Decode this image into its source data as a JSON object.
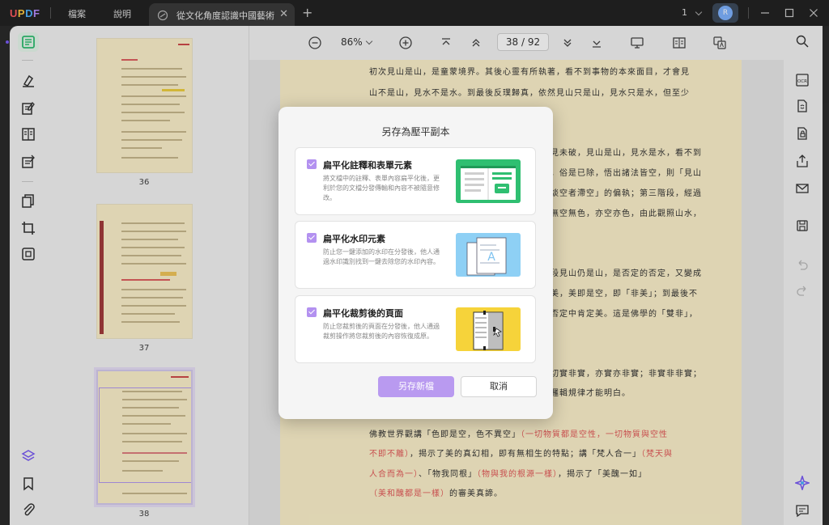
{
  "app": {
    "logo_u": "U",
    "logo_p": "P",
    "logo_d": "D",
    "logo_f": "F"
  },
  "menu": {
    "file": "檔案",
    "help": "說明"
  },
  "tab": {
    "title": "從文化角度認識中國藝術"
  },
  "titlebar": {
    "page_count": "1",
    "avatar_initial": "R"
  },
  "toolbar": {
    "zoom": "86%",
    "current_page": "38",
    "page_separator": "/",
    "total_pages": "92"
  },
  "thumbnails": [
    {
      "label": "36"
    },
    {
      "label": "37"
    },
    {
      "label": "38"
    }
  ],
  "document": {
    "lines": [
      {
        "text": "初次見山是山，是童蒙境界。其後心靈有所執著，看不到事物的本來面目，才會見"
      },
      {
        "text": "山不是山，見水不是水。到最後反璞歸真，依然見山只是山，見水只是水，但至少"
      },
      {
        "text": "見未破，見山是山，見水是水，看不到"
      },
      {
        "text": "，俗是已除，悟出諸法皆空，則「見山"
      },
      {
        "text": "談空者滯空」的偏執；第三階段，經過"
      },
      {
        "text": "無空無色，亦空亦色，由此觀照山水，"
      },
      {
        "text": "段見山仍是山，是否定的否定，又變成"
      },
      {
        "text": "美，美即是空，即「非美」；到最後不"
      },
      {
        "text": "否定中肯定美。這是佛學的「雙非」，"
      },
      {
        "text": "切實非實，亦實亦非實；非實非非實；"
      },
      {
        "text": "邏輯規律才能明白。"
      },
      {
        "text": "佛教世界觀講「色即是空，色不異空」",
        "red": "（一切物質都是空性，一切物質與空性"
      },
      {
        "text": "，揭示了美的真幻相，即有無相生的特點；講「梵人合一」",
        "red_pre": "不即不離）",
        "red": "（梵天與"
      },
      {
        "text": "、「物我同根」",
        "red_pre": "人合而為一）",
        "red": "（物與我的根源一樣）",
        "tail": "，揭示了「美醜一如」"
      },
      {
        "text": "的審美真諦。",
        "red_pre": "（美和醜都是一樣）"
      }
    ]
  },
  "dialog": {
    "title": "另存為壓平副本",
    "options": [
      {
        "title": "扁平化註釋和表單元素",
        "desc": "將文檔中的註釋、表單內容扁平化後，更利於您的文檔分發傳輸和內容不被隨意修改。"
      },
      {
        "title": "扁平化水印元素",
        "desc": "防止您一鍵添加的水印在分發後，他人通過水印識別找到一鍵去除您的水印內容。"
      },
      {
        "title": "扁平化裁剪後的頁面",
        "desc": "防止您裁剪後的頁面在分發後，他人通過裁剪操作將您裁剪後的內容恢復成原。"
      }
    ],
    "save_label": "另存新檔",
    "cancel_label": "取消"
  },
  "colors": {
    "accent": "#b99af0",
    "page_bg": "#fdf2cc",
    "link_red": "#e45a5a",
    "brand_green": "#2fbf71"
  }
}
